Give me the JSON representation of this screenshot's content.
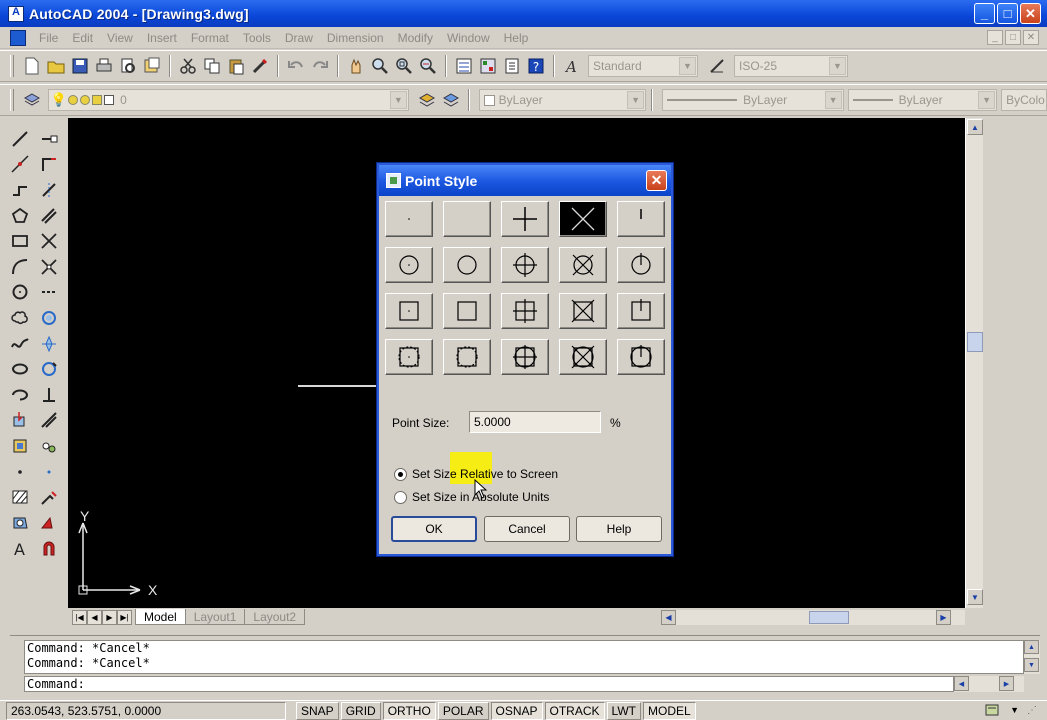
{
  "window": {
    "title": "AutoCAD 2004 - [Drawing3.dwg]",
    "min_label": "_",
    "max_label": "□",
    "close_label": "✕"
  },
  "menu": [
    "File",
    "Edit",
    "View",
    "Insert",
    "Format",
    "Tools",
    "Draw",
    "Dimension",
    "Modify",
    "Window",
    "Help"
  ],
  "mdi_buttons": [
    "_",
    "□",
    "✕"
  ],
  "toolbar": {
    "text_style": "Standard",
    "dim_style": "ISO-25",
    "layer": "0",
    "color": "ByLayer",
    "linetype": "ByLayer",
    "lineweight": "ByLayer",
    "plot_style": "ByColo"
  },
  "tabs": [
    "Model",
    "Layout1",
    "Layout2"
  ],
  "ucs": {
    "x_label": "X",
    "y_label": "Y"
  },
  "command": {
    "history": [
      "Command:  *Cancel*",
      "Command:  *Cancel*"
    ],
    "prompt": "Command:"
  },
  "status": {
    "coords": "263.0543, 523.5751, 0.0000",
    "toggles": [
      {
        "label": "SNAP",
        "on": false
      },
      {
        "label": "GRID",
        "on": false
      },
      {
        "label": "ORTHO",
        "on": true
      },
      {
        "label": "POLAR",
        "on": false
      },
      {
        "label": "OSNAP",
        "on": true
      },
      {
        "label": "OTRACK",
        "on": true
      },
      {
        "label": "LWT",
        "on": false
      },
      {
        "label": "MODEL",
        "on": true
      }
    ]
  },
  "dialog": {
    "title": "Point Style",
    "point_size_label": "Point Size:",
    "point_size_value": "5.0000",
    "percent": "%",
    "radio_relative": "Set Size Relative to Screen",
    "radio_absolute": "Set Size in Absolute Units",
    "selected_radio": "relative",
    "selected_style_index": 3,
    "ok": "OK",
    "cancel": "Cancel",
    "help": "Help"
  },
  "colors": {
    "title_blue": "#0a46d8",
    "highlight": "#f8f000",
    "canvas": "#000000"
  }
}
